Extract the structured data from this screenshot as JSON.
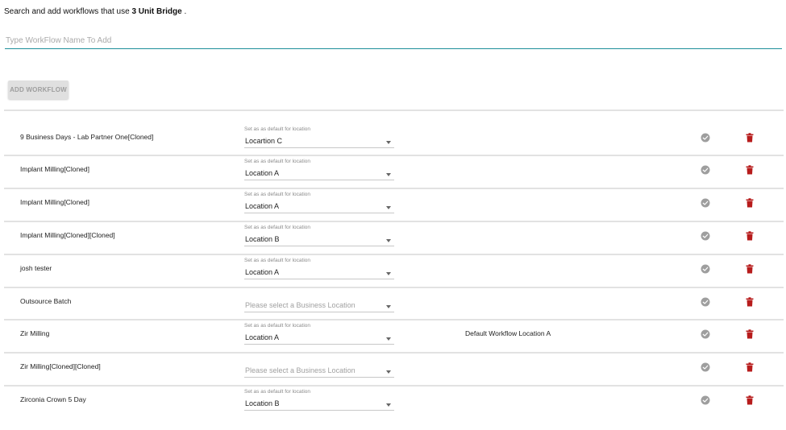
{
  "intro": {
    "prefix": "Search and add workflows that use",
    "product": "3 Unit Bridge",
    "suffix": "."
  },
  "search": {
    "placeholder": "Type WorkFlow Name To Add",
    "value": ""
  },
  "add_button_label": "ADD WORKFLOW",
  "location_label": "Set as as default for location",
  "colors": {
    "accent": "#1e8f9a",
    "trash": "#b71c1c",
    "check": "#9e9e9e"
  },
  "workflows": [
    {
      "name": "9 Business Days - Lab Partner One[Cloned]",
      "location": "Locartion C",
      "placeholder": false,
      "default_note": ""
    },
    {
      "name": "Implant Milling[Cloned]",
      "location": "Location A",
      "placeholder": false,
      "default_note": ""
    },
    {
      "name": "Implant Milling[Cloned]",
      "location": "Location A",
      "placeholder": false,
      "default_note": ""
    },
    {
      "name": "Implant Milling[Cloned][Cloned]",
      "location": "Location B",
      "placeholder": false,
      "default_note": ""
    },
    {
      "name": "josh tester",
      "location": "Location A",
      "placeholder": false,
      "default_note": ""
    },
    {
      "name": "Outsource Batch",
      "location": "Please select a Business Location",
      "placeholder": true,
      "default_note": ""
    },
    {
      "name": "Zir Milling",
      "location": "Location A",
      "placeholder": false,
      "default_note": "Default Workflow Location A"
    },
    {
      "name": "Zir Milling[Cloned][Cloned]",
      "location": "Please select a Business Location",
      "placeholder": true,
      "default_note": ""
    },
    {
      "name": "Zirconia Crown 5 Day",
      "location": "Location B",
      "placeholder": false,
      "default_note": ""
    }
  ]
}
